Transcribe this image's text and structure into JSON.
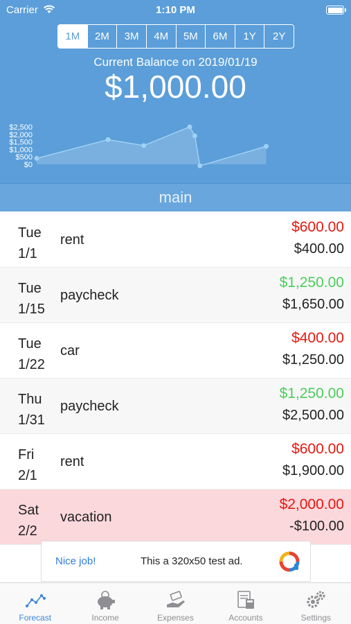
{
  "status_bar": {
    "carrier": "Carrier",
    "time": "1:10 PM"
  },
  "ranges": [
    {
      "label": "1M",
      "active": true
    },
    {
      "label": "2M",
      "active": false
    },
    {
      "label": "3M",
      "active": false
    },
    {
      "label": "4M",
      "active": false
    },
    {
      "label": "5M",
      "active": false
    },
    {
      "label": "6M",
      "active": false
    },
    {
      "label": "1Y",
      "active": false
    },
    {
      "label": "2Y",
      "active": false
    }
  ],
  "balance": {
    "label": "Current Balance on 2019/01/19",
    "amount": "$1,000.00"
  },
  "chart_data": {
    "type": "area",
    "y_tick_labels": [
      "$2,500",
      "$2,000",
      "$1,500",
      "$1,000",
      "$500",
      "$0"
    ],
    "y_ticks": [
      2500,
      2000,
      1500,
      1000,
      500,
      0
    ],
    "ylim": [
      0,
      2500
    ],
    "xlim": [
      0,
      60
    ],
    "series": [
      {
        "x": [
          0,
          14,
          21,
          30,
          31,
          32,
          45
        ],
        "values": [
          400,
          1650,
          1250,
          2500,
          1900,
          -100,
          1200
        ]
      }
    ],
    "line_color": "#9fd1f5",
    "fill_color": "#7fb3e0"
  },
  "account": {
    "name": "main"
  },
  "transactions": [
    {
      "weekday": "Tue",
      "date": "1/1",
      "payee": "rent",
      "amount": "$600.00",
      "kind": "expense",
      "balance": "$400.00",
      "negative": false
    },
    {
      "weekday": "Tue",
      "date": "1/15",
      "payee": "paycheck",
      "amount": "$1,250.00",
      "kind": "income",
      "balance": "$1,650.00",
      "negative": false
    },
    {
      "weekday": "Tue",
      "date": "1/22",
      "payee": "car",
      "amount": "$400.00",
      "kind": "expense",
      "balance": "$1,250.00",
      "negative": false
    },
    {
      "weekday": "Thu",
      "date": "1/31",
      "payee": "paycheck",
      "amount": "$1,250.00",
      "kind": "income",
      "balance": "$2,500.00",
      "negative": false
    },
    {
      "weekday": "Fri",
      "date": "2/1",
      "payee": "rent",
      "amount": "$600.00",
      "kind": "expense",
      "balance": "$1,900.00",
      "negative": false
    },
    {
      "weekday": "Sat",
      "date": "2/2",
      "payee": "vacation",
      "amount": "$2,000.00",
      "kind": "expense",
      "balance": "-$100.00",
      "negative": true
    }
  ],
  "ad": {
    "title": "Nice job!",
    "text": "This a 320x50 test ad."
  },
  "tabs": [
    {
      "label": "Forecast",
      "icon": "forecast-icon",
      "active": true
    },
    {
      "label": "Income",
      "icon": "piggy-bank-icon",
      "active": false
    },
    {
      "label": "Expenses",
      "icon": "hand-money-icon",
      "active": false
    },
    {
      "label": "Accounts",
      "icon": "ledger-calculator-icon",
      "active": false
    },
    {
      "label": "Settings",
      "icon": "gears-icon",
      "active": false
    }
  ],
  "colors": {
    "header_bg": "#5b9ed9",
    "expense": "#e8170f",
    "income": "#4ccd5a",
    "negative_row": "#fbd8dc",
    "tab_active": "#3b86d8"
  }
}
